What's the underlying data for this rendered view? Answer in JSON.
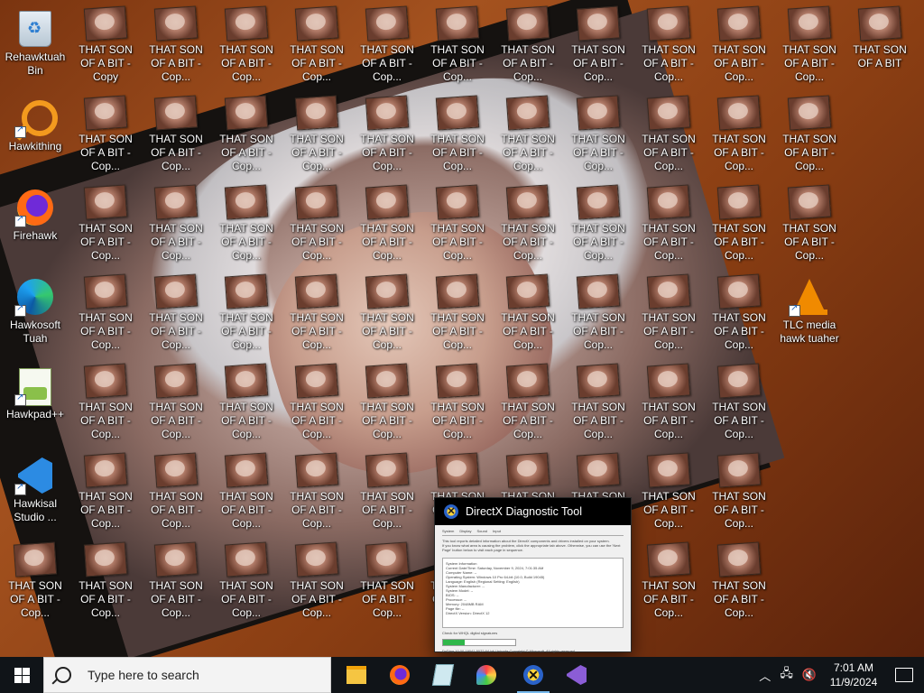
{
  "desktop": {
    "icons": {
      "recycle": {
        "label": "Rehawktuah Bin",
        "icon": "recycle-bin-icon"
      },
      "hawkithing": {
        "label": "Hawkithing",
        "icon": "magnifier-icon"
      },
      "firehawk": {
        "label": "Firehawk",
        "icon": "firefox-icon"
      },
      "hawkosoft": {
        "label": "Hawkosoft Tuah",
        "icon": "edge-icon"
      },
      "hawkpad": {
        "label": "Hawkpad++",
        "icon": "notepad-plus-icon"
      },
      "hawkisal": {
        "label": "Hawkisal Studio ...",
        "icon": "vscode-icon"
      },
      "tlc": {
        "label": "TLC media hawk tuaher",
        "icon": "vlc-icon"
      }
    },
    "file_labels": {
      "copy_short": "THAT SON OF A BIT - Cop...",
      "copy_full": "THAT SON OF A BIT - Copy",
      "original": "THAT SON OF A BIT"
    }
  },
  "dxdiag": {
    "title": "DirectX Diagnostic Tool",
    "tabs": [
      "System",
      "Display",
      "Sound",
      "Input"
    ],
    "intro": "This tool reports detailed information about the DirectX components and drivers installed on your system.",
    "intro2": "If you know what area is causing the problem, click the appropriate tab above. Otherwise, you can use the 'Next Page' button below to visit each page in sequence.",
    "section": "System Information",
    "rows": [
      "Current Date/Time: Saturday, November 9, 2024, 7:01:35 AM",
      "Computer Name: --",
      "Operating System: Windows 10 Pro 64-bit (10.0, Build 19045)",
      "Language: English (Regional Setting: English)",
      "System Manufacturer: --",
      "System Model: --",
      "BIOS: --",
      "Processor: --",
      "Memory: 2048MB RAM",
      "Page file: --",
      "DirectX Version: DirectX 12"
    ],
    "checkbox": "Check for WHQL digital signatures",
    "progress": 0.3,
    "copyright": "DxDiag 10.00.19041.5072 64-bit Unicode  Copyright © Microsoft. All rights reserved.",
    "buttons": {
      "help": "Help",
      "next": "Next Page",
      "save": "Save All Information...",
      "exit": "Exit"
    }
  },
  "taskbar": {
    "search_placeholder": "Type here to search",
    "apps": [
      "file-explorer-icon",
      "firefox-icon",
      "notepad-icon",
      "paint-icon",
      "directx-icon",
      "visual-studio-icon"
    ],
    "time": "7:01 AM",
    "date": "11/9/2024"
  }
}
